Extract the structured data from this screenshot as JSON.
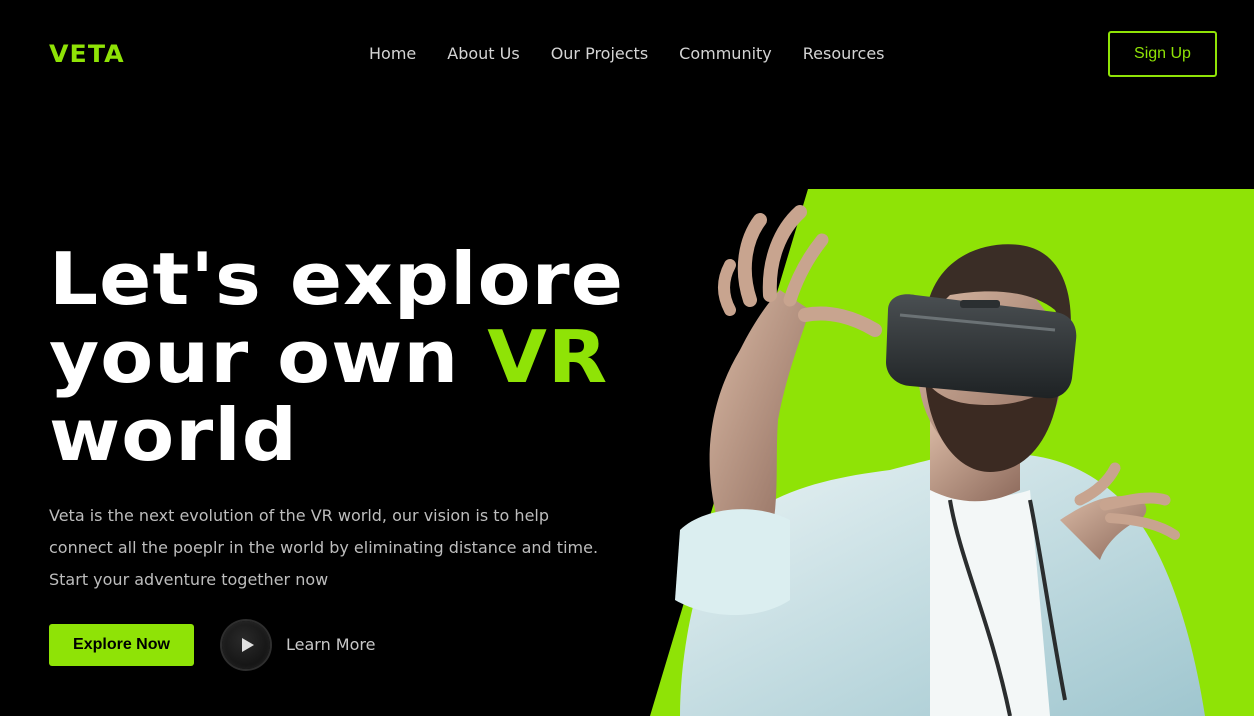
{
  "colors": {
    "accent": "#8fe306",
    "background": "#000000",
    "text": "#ffffff",
    "muted_text": "#bdbdbd"
  },
  "header": {
    "logo": "VETA",
    "nav": [
      "Home",
      "About Us",
      "Our Projects",
      "Community",
      "Resources"
    ],
    "signup_label": "Sign Up"
  },
  "hero": {
    "headline_line1": "Let's explore",
    "headline_line2_white": "your own ",
    "headline_line2_accent": "VR",
    "headline_line3": "world",
    "description": [
      "Veta is the next evolution of the VR world, our vision is to help",
      "connect all the poeplr in the world by eliminating distance and time.",
      "Start your adventure together now"
    ],
    "primary_cta": "Explore Now",
    "play_icon": "play-icon",
    "secondary_cta": "Learn More",
    "image_subject": "man-wearing-vr-headset"
  }
}
